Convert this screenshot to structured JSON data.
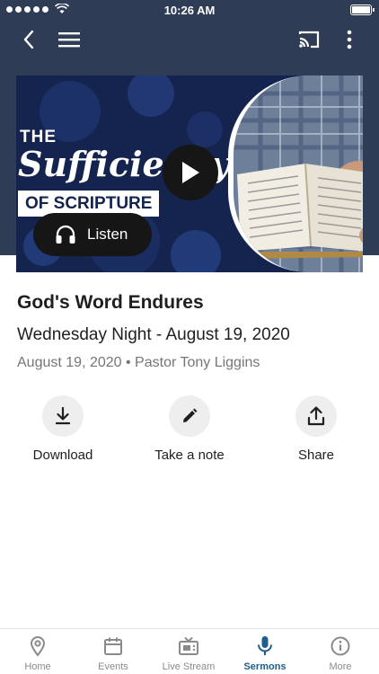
{
  "status_bar": {
    "time": "10:26 AM"
  },
  "hero": {
    "art_line1": "THE",
    "art_line2": "Sufficiency",
    "art_line3": "OF SCRIPTURE",
    "listen_label": "Listen"
  },
  "sermon": {
    "title": "God's Word Endures",
    "series": "Wednesday Night - August 19, 2020",
    "date": "August 19, 2020",
    "speaker": "Pastor Tony Liggins"
  },
  "actions": [
    {
      "label": "Download",
      "icon": "download-icon"
    },
    {
      "label": "Take a note",
      "icon": "pencil-icon"
    },
    {
      "label": "Share",
      "icon": "share-icon"
    }
  ],
  "tabs": [
    {
      "label": "Home",
      "icon": "location-pin-icon"
    },
    {
      "label": "Events",
      "icon": "calendar-icon"
    },
    {
      "label": "Live Stream",
      "icon": "tv-icon"
    },
    {
      "label": "Sermons",
      "icon": "microphone-icon",
      "active": true
    },
    {
      "label": "More",
      "icon": "info-icon"
    }
  ],
  "colors": {
    "header": "#2f3c56",
    "accent": "#1f5d8d",
    "hero_bg": "#14244e",
    "button_dark": "#161616",
    "muted_text": "#767676"
  }
}
